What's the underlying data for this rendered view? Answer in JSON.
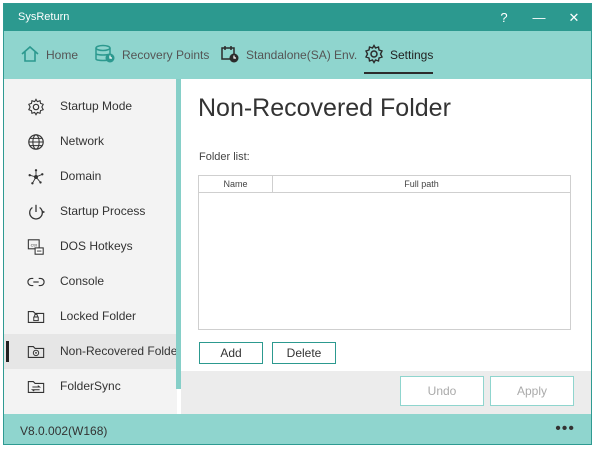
{
  "window": {
    "title": "SysReturn",
    "help_glyph": "?",
    "minimize_glyph": "—",
    "close_glyph": "✕"
  },
  "nav": {
    "items": [
      {
        "label": "Home",
        "icon": "home-icon"
      },
      {
        "label": "Recovery Points",
        "icon": "database-clock-icon"
      },
      {
        "label": "Standalone(SA) Env.",
        "icon": "calendar-clock-icon"
      },
      {
        "label": "Settings",
        "icon": "gear-icon",
        "active": true
      }
    ]
  },
  "sidebar": {
    "items": [
      {
        "label": "Startup Mode",
        "icon": "gear-outline-icon"
      },
      {
        "label": "Network",
        "icon": "globe-icon"
      },
      {
        "label": "Domain",
        "icon": "network-nodes-icon"
      },
      {
        "label": "Startup Process",
        "icon": "power-process-icon"
      },
      {
        "label": "DOS Hotkeys",
        "icon": "keyboard-ctrl-icon"
      },
      {
        "label": "Console",
        "icon": "console-link-icon"
      },
      {
        "label": "Locked Folder",
        "icon": "locked-folder-icon"
      },
      {
        "label": "Non-Recovered Folder",
        "icon": "non-recovered-folder-icon",
        "active": true
      },
      {
        "label": "FolderSync",
        "icon": "folder-sync-icon"
      }
    ]
  },
  "main": {
    "title": "Non-Recovered Folder",
    "folder_list_label": "Folder list:",
    "table": {
      "columns": [
        "Name",
        "Full path"
      ],
      "rows": []
    },
    "add_label": "Add",
    "delete_label": "Delete"
  },
  "actions": {
    "undo_label": "Undo",
    "apply_label": "Apply"
  },
  "status": {
    "version": "V8.0.002(W168)",
    "more_glyph": "•••"
  },
  "colors": {
    "titlebar": "#2c998f",
    "accent_light": "#8fd5ce",
    "sidebar_bg": "#f3f3f3"
  }
}
